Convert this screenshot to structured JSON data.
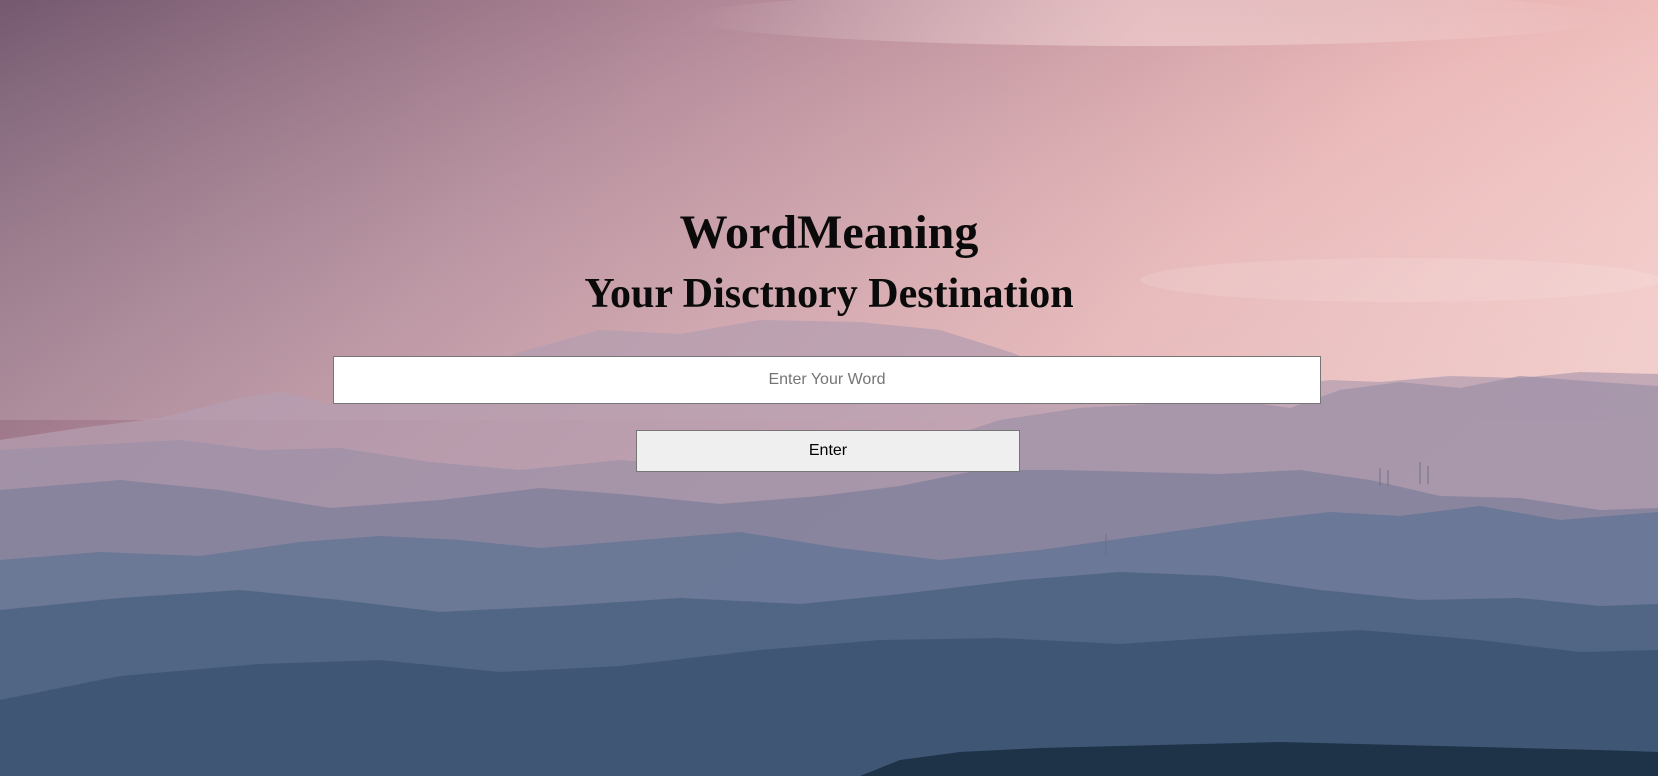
{
  "header": {
    "title": "WordMeaning",
    "subtitle": "Your Disctnory Destination"
  },
  "search": {
    "value": "",
    "placeholder": "Enter Your Word"
  },
  "actions": {
    "enter_label": "Enter"
  },
  "colors": {
    "sky_top": "#7a6176",
    "sky_pink": "#f2c4c4",
    "mountain_far": "#a9a3b4",
    "mountain_near": "#3c5670",
    "button_bg": "#efefef"
  }
}
